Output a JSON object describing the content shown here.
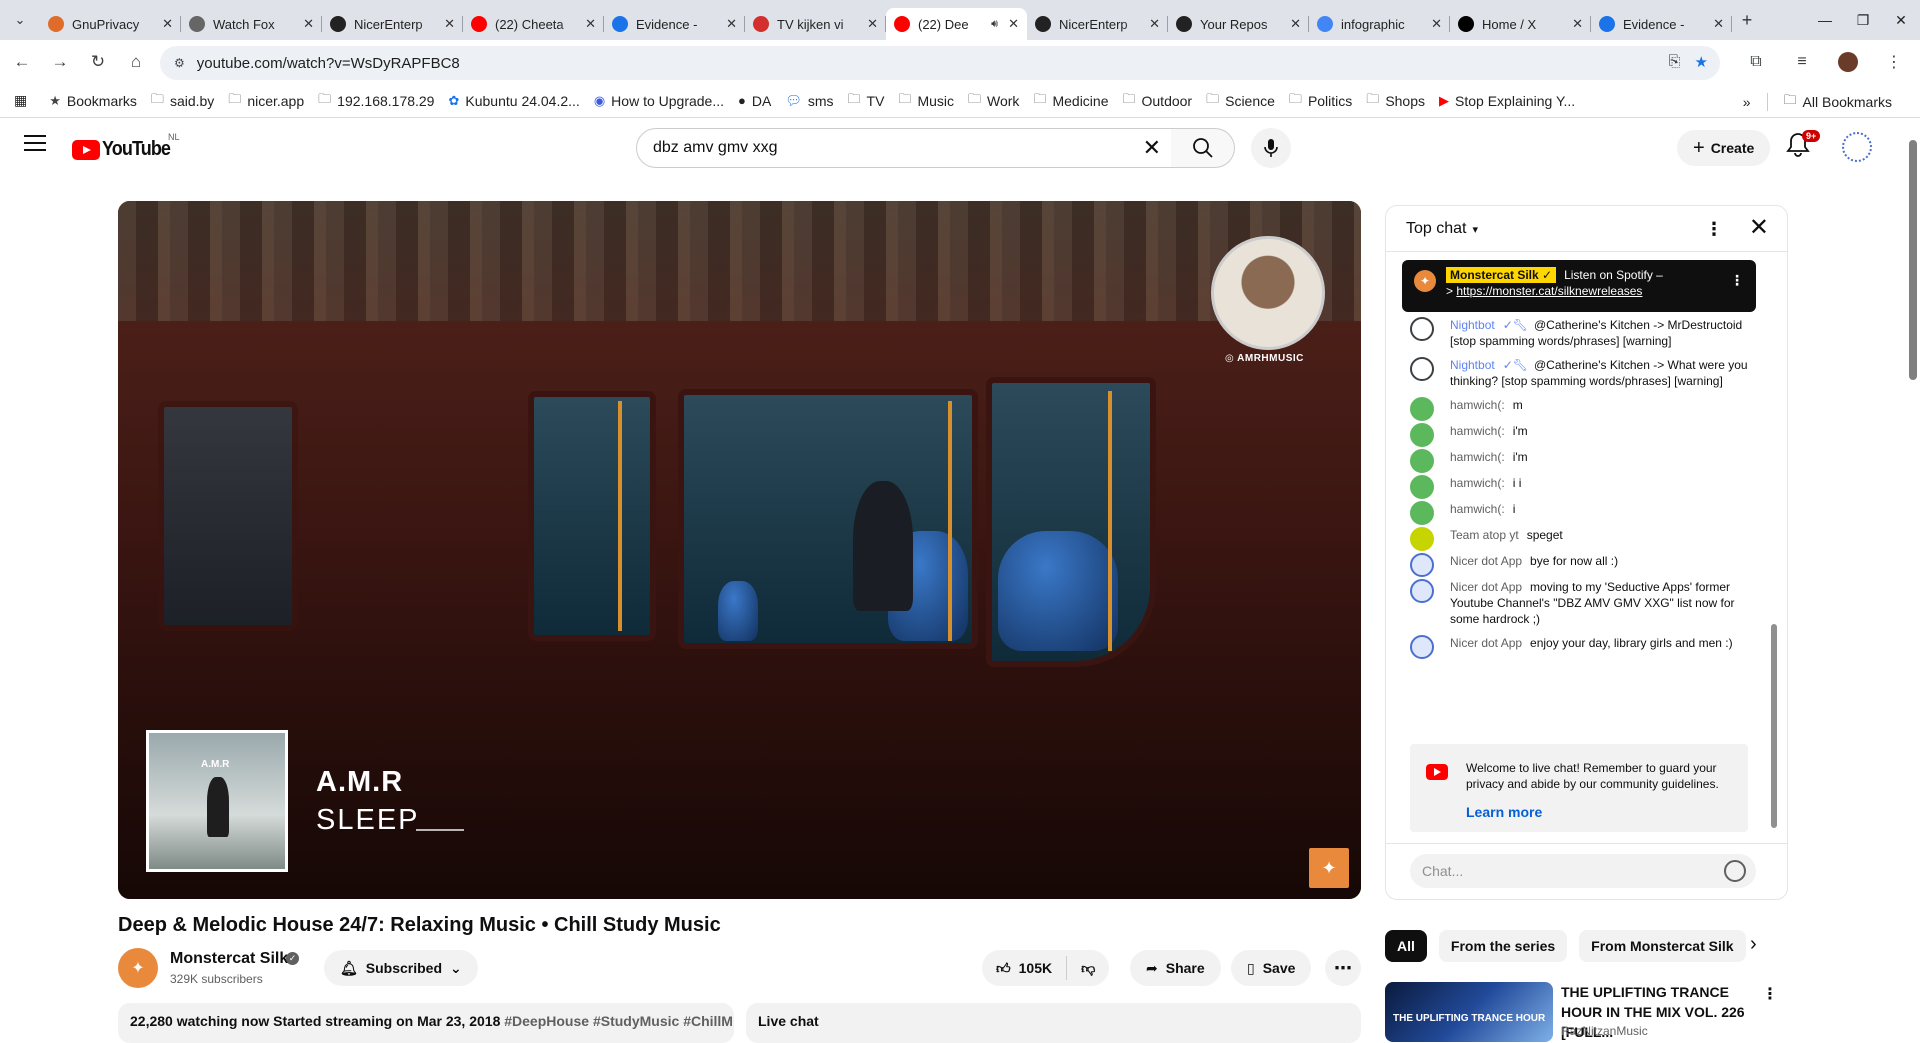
{
  "browser": {
    "tabs": [
      {
        "title": "GnuPrivacy",
        "favicon_color": "#e06c2c",
        "active": false
      },
      {
        "title": "Watch Fox",
        "favicon_color": "#666666",
        "active": false
      },
      {
        "title": "NicerEnterp",
        "favicon_color": "#222222",
        "active": false
      },
      {
        "title": "(22) Cheeta",
        "favicon_color": "#ff0000",
        "active": false
      },
      {
        "title": "Evidence -",
        "favicon_color": "#1a73e8",
        "active": false
      },
      {
        "title": "TV kijken vi",
        "favicon_color": "#d32f2f",
        "active": false
      },
      {
        "title": "(22) Dee",
        "favicon_color": "#ff0000",
        "active": true,
        "audio": true
      },
      {
        "title": "NicerEnterp",
        "favicon_color": "#222222",
        "active": false
      },
      {
        "title": "Your Repos",
        "favicon_color": "#222222",
        "active": false
      },
      {
        "title": "infographic",
        "favicon_color": "#4285f4",
        "active": false
      },
      {
        "title": "Home / X",
        "favicon_color": "#000000",
        "active": false
      },
      {
        "title": "Evidence -",
        "favicon_color": "#1a73e8",
        "active": false
      }
    ],
    "url": "youtube.com/watch?v=WsDyRAPFBC8",
    "bookmarks": [
      {
        "label": "Bookmarks",
        "icon": "star-icon"
      },
      {
        "label": "said.by",
        "icon": "folder-icon"
      },
      {
        "label": "nicer.app",
        "icon": "folder-icon"
      },
      {
        "label": "192.168.178.29",
        "icon": "folder-icon"
      },
      {
        "label": "Kubuntu 24.04.2...",
        "icon": "gear-icon"
      },
      {
        "label": "How to Upgrade...",
        "icon": "globe-icon"
      },
      {
        "label": "DA",
        "icon": "github-icon"
      },
      {
        "label": "sms",
        "icon": "chat-icon"
      },
      {
        "label": "TV",
        "icon": "folder-icon"
      },
      {
        "label": "Music",
        "icon": "folder-icon"
      },
      {
        "label": "Work",
        "icon": "folder-icon"
      },
      {
        "label": "Medicine",
        "icon": "folder-icon"
      },
      {
        "label": "Outdoor",
        "icon": "folder-icon"
      },
      {
        "label": "Science",
        "icon": "folder-icon"
      },
      {
        "label": "Politics",
        "icon": "folder-icon"
      },
      {
        "label": "Shops",
        "icon": "folder-icon"
      },
      {
        "label": "Stop Explaining Y...",
        "icon": "youtube-icon"
      }
    ],
    "overflow_label": "»",
    "all_bookmarks": "All Bookmarks"
  },
  "youtube": {
    "country": "NL",
    "logo_word": "YouTube",
    "search_value": "dbz amv gmv xxg",
    "create_label": "Create",
    "notif_badge": "9+",
    "player": {
      "presenter_handle": "AMRHMUSIC",
      "album_title": "A.M.R",
      "track_artist": "A.M.R",
      "track_title": "SLEEP"
    },
    "video_title": "Deep & Melodic House 24/7: Relaxing Music • Chill Study Music",
    "channel_name": "Monstercat Silk",
    "subscribers": "329K subscribers",
    "subscribed_label": "Subscribed",
    "likes": "105K",
    "share_label": "Share",
    "save_label": "Save",
    "description_stats": "22,280 watching now  Started streaming on Mar 23, 2018 ",
    "description_tags": "#DeepHouse #StudyMusic #ChillM",
    "live_chat_label": "Live chat",
    "chat": {
      "title": "Top chat",
      "pinned": {
        "author": "Monstercat Silk ✓",
        "text1": "Listen on Spotify –",
        "text2_prefix": "> ",
        "link": "https://monster.cat/silknewreleases"
      },
      "messages": [
        {
          "author": "Nightbot",
          "mod": true,
          "text": "@Catherine's Kitchen -> MrDestructoid [stop spamming words/phrases] [warning]",
          "avatar_color": "#ffffff"
        },
        {
          "author": "Nightbot",
          "mod": true,
          "text": "@Catherine's Kitchen -> What were you thinking? [stop spamming words/phrases] [warning]",
          "avatar_color": "#ffffff"
        },
        {
          "author": "hamwich(:",
          "mod": false,
          "text": "m",
          "avatar_color": "#5cb85c"
        },
        {
          "author": "hamwich(:",
          "mod": false,
          "text": "i'm",
          "avatar_color": "#5cb85c"
        },
        {
          "author": "hamwich(:",
          "mod": false,
          "text": "i'm",
          "avatar_color": "#5cb85c"
        },
        {
          "author": "hamwich(:",
          "mod": false,
          "text": "i i",
          "avatar_color": "#5cb85c"
        },
        {
          "author": "hamwich(:",
          "mod": false,
          "text": "i",
          "avatar_color": "#5cb85c"
        },
        {
          "author": "Team atop yt",
          "mod": false,
          "text": "speget",
          "avatar_color": "#c6d400"
        },
        {
          "author": "Nicer dot App",
          "mod": false,
          "text": "bye for now all :)",
          "avatar_color": "#dfe7fb"
        },
        {
          "author": "Nicer dot App",
          "mod": false,
          "text": "moving to my 'Seductive Apps' former Youtube Channel's \"DBZ AMV GMV XXG\" list now for some hardrock ;)",
          "avatar_color": "#dfe7fb"
        },
        {
          "author": "Nicer dot App",
          "mod": false,
          "text": "enjoy your day, library girls and men :)",
          "avatar_color": "#dfe7fb"
        }
      ],
      "welcome_text": "Welcome to live chat! Remember to guard your privacy and abide by our community guidelines.",
      "learn_more": "Learn more",
      "input_placeholder": "Chat..."
    },
    "chips": [
      "All",
      "From the series",
      "From Monstercat Silk"
    ],
    "recommendation": {
      "title": "THE UPLIFTING TRANCE HOUR IN THE MIX VOL. 226 [FULL...",
      "channel": "RazNitzanMusic",
      "thumb_text": "THE UPLIFTING TRANCE HOUR"
    }
  }
}
